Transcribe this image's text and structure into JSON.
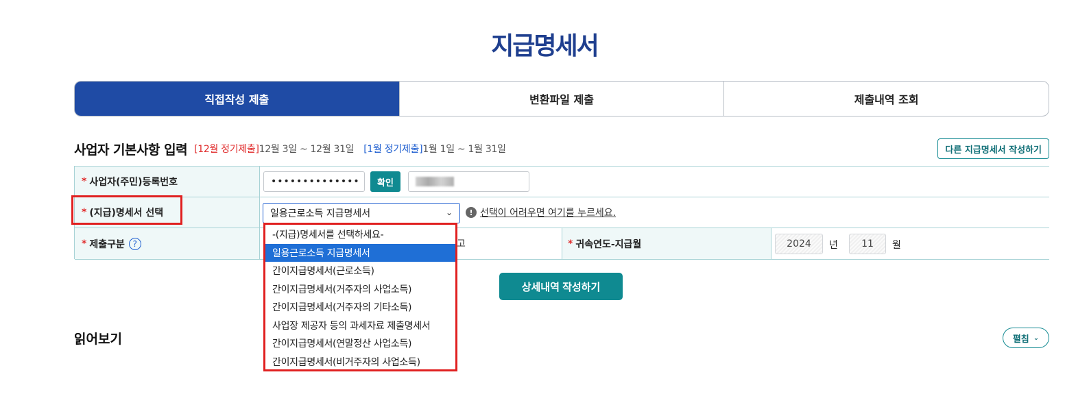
{
  "page": {
    "title": "지급명세서"
  },
  "tabs": [
    {
      "label": "직접작성 제출",
      "active": true
    },
    {
      "label": "변환파일 제출",
      "active": false
    },
    {
      "label": "제출내역 조회",
      "active": false
    }
  ],
  "section": {
    "title": "사업자 기본사항 입력",
    "period1_tag": "[12월 정기제출]",
    "period1_range": "12월 3일 ~ 12월 31일",
    "period2_tag": "[1월 정기제출]",
    "period2_range": "1월 1일 ~ 1월 31일",
    "other_button": "다른 지급명세서 작성하기"
  },
  "form": {
    "required_mark": "*",
    "biz_no_label": "사업자(주민)등록번호",
    "biz_no_value": "••••••••••••••",
    "confirm_button": "확인",
    "statement_label": "(지급)명세서 선택",
    "statement_selected": "일용근로소득 지급명세서",
    "help_text": "선택이 어려우면 여기를 누르세요.",
    "submit_type_label": "제출구분",
    "submit_type_partial": "고",
    "attribution_label": "귀속연도-지급월",
    "year_value": "2024",
    "year_unit": "년",
    "month_value": "11",
    "month_unit": "월"
  },
  "dropdown_options": [
    "-(지급)명세서를 선택하세요-",
    "일용근로소득 지급명세서",
    "간이지급명세서(근로소득)",
    "간이지급명세서(거주자의 사업소득)",
    "간이지급명세서(거주자의 기타소득)",
    "사업장 제공자 등의 과세자료 제출명세서",
    "간이지급명세서(연말정산 사업소득)",
    "간이지급명세서(비거주자의 사업소득)"
  ],
  "selected_option_index": 1,
  "detail_button": "상세내역 작성하기",
  "read_section": {
    "title": "읽어보기",
    "expand_label": "펼침"
  },
  "colors": {
    "primary": "#1f4ba5",
    "teal": "#0f8a91",
    "highlight": "#e02020"
  }
}
